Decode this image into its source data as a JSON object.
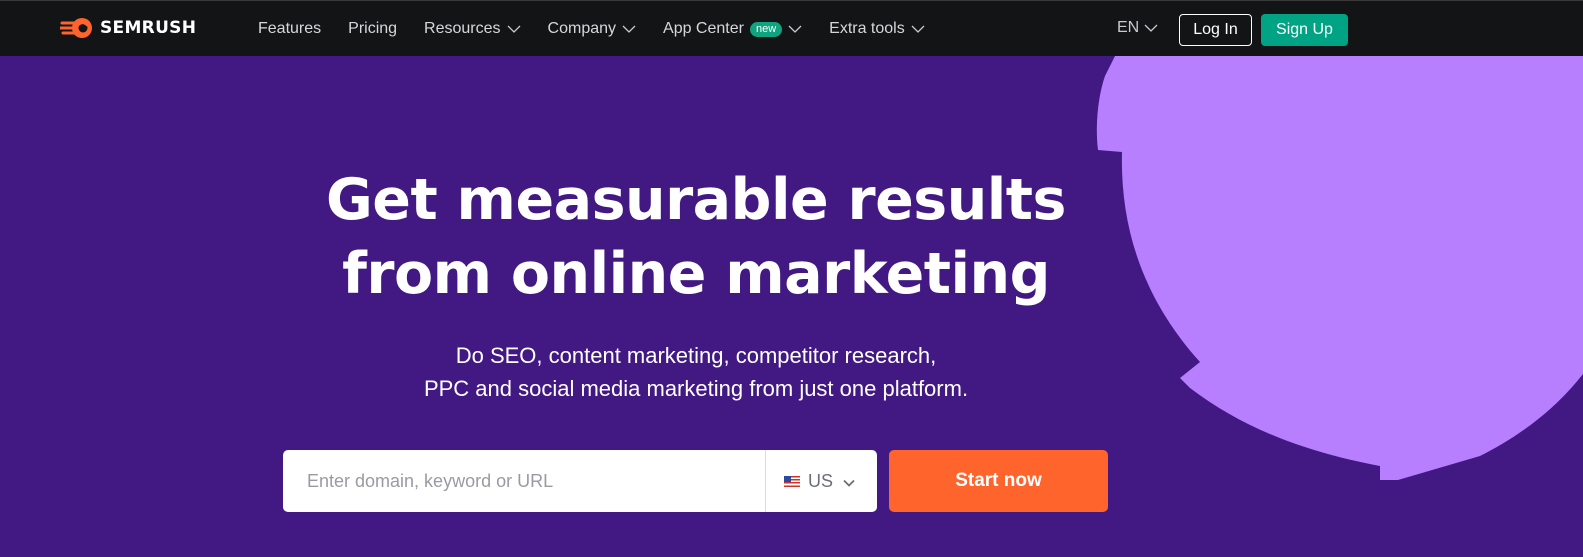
{
  "brand": {
    "name": "SEMRUSH",
    "logo_icon": "semrush-fireball-icon",
    "accent": "#ff642d"
  },
  "nav": {
    "items": [
      {
        "label": "Features",
        "has_dropdown": false
      },
      {
        "label": "Pricing",
        "has_dropdown": false
      },
      {
        "label": "Resources",
        "has_dropdown": true
      },
      {
        "label": "Company",
        "has_dropdown": true
      },
      {
        "label": "App Center",
        "has_dropdown": true,
        "badge": "new"
      },
      {
        "label": "Extra tools",
        "has_dropdown": true
      }
    ]
  },
  "header": {
    "language": "EN",
    "login_label": "Log In",
    "signup_label": "Sign Up",
    "signup_color": "#00a383"
  },
  "hero": {
    "title_line1": "Get measurable results",
    "title_line2": "from online marketing",
    "subtitle_line1": "Do SEO, content marketing, competitor research,",
    "subtitle_line2": "PPC and social media marketing from just one platform.",
    "background": "#421983",
    "decoration_color": "#b77ffe"
  },
  "search": {
    "placeholder": "Enter domain, keyword or URL",
    "value": "",
    "country": "US",
    "country_icon": "us-flag-icon",
    "submit_label": "Start now"
  }
}
